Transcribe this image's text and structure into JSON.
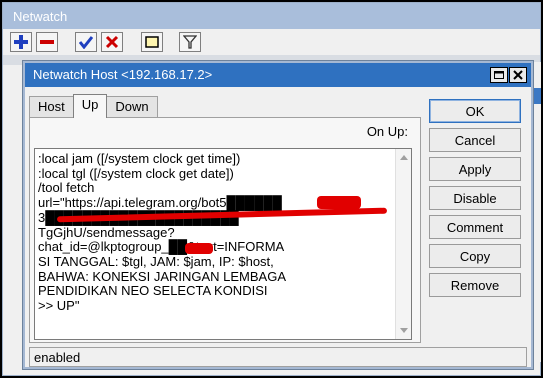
{
  "bg_window": {
    "title": "Netwatch",
    "toolbar": [
      {
        "name": "add-button",
        "icon": "plus-icon",
        "color": "#1f3fbf"
      },
      {
        "name": "remove-button",
        "icon": "minus-icon",
        "color": "#cc0000"
      },
      {
        "name": "enable-button",
        "icon": "checkmark-icon",
        "color": "#1f3fbf"
      },
      {
        "name": "disable-button",
        "icon": "x-icon",
        "color": "#cc0000"
      },
      {
        "name": "comment-button",
        "icon": "note-icon",
        "color": "#d4b000"
      },
      {
        "name": "filter-button",
        "icon": "filter-icon",
        "color": "#333333"
      }
    ]
  },
  "dialog": {
    "title": "Netwatch Host <192.168.17.2>",
    "tabs": [
      {
        "label": "Host",
        "active": false
      },
      {
        "label": "Up",
        "active": true
      },
      {
        "label": "Down",
        "active": false
      }
    ],
    "on_up_label": "On Up:",
    "script_text": ":local jam ([/system clock get time])\n:local tgl ([/system clock get date])\n/tool fetch\nurl=\"https://api.telegram.org/bot5██████\n3█████████████████████\nTgGjhU/sendmessage?\nchat_id=@lkptogroup_██&text=INFORMA\nSI TANGGAL: $tgl, JAM: $jam, IP: $host,\nBAHWA: KONEKSI JARINGAN LEMBAGA\nPENDIDIKAN NEO SELECTA KONDISI\n>> UP\"",
    "buttons": [
      "OK",
      "Cancel",
      "Apply",
      "Disable",
      "Comment",
      "Copy",
      "Remove"
    ],
    "status": "enabled",
    "colors": {
      "titlebar": "#2f71c0",
      "redaction": "#e10000"
    }
  }
}
